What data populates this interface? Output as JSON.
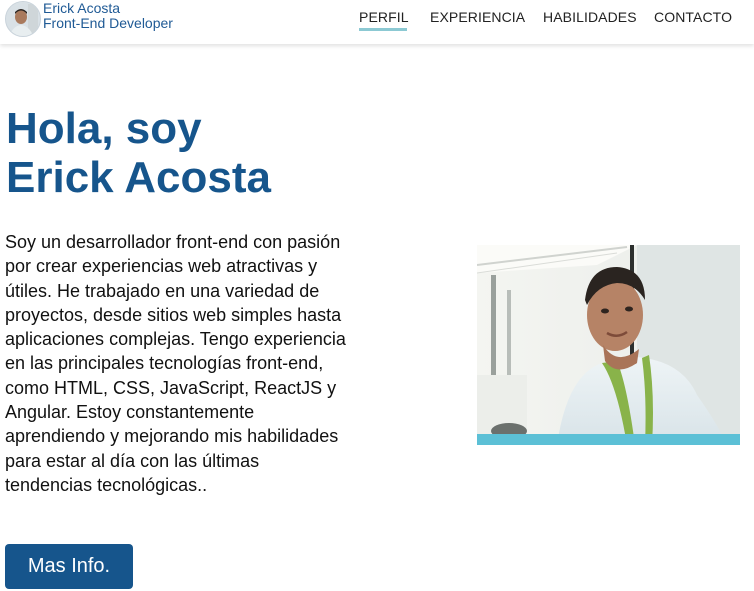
{
  "header": {
    "name": "Erick Acosta",
    "role": "Front-End Developer",
    "nav": [
      {
        "label": "PERFIL",
        "active": true
      },
      {
        "label": "EXPERIENCIA",
        "active": false
      },
      {
        "label": "HABILIDADES",
        "active": false
      },
      {
        "label": "CONTACTO",
        "active": false
      }
    ]
  },
  "hero": {
    "title_line1": "Hola, soy",
    "title_line2": "Erick Acosta",
    "bio": "Soy un desarrollador front-end con pasión por crear experiencias web atractivas y útiles. He trabajado en una variedad de proyectos, desde sitios web simples hasta aplicaciones complejas. Tengo experiencia en las principales tecnologías front-end, como HTML, CSS, JavaScript, ReactJS y Angular. Estoy constantemente aprendiendo y mejorando mis habilidades para estar al día con las últimas tendencias tecnológicas..",
    "cta_label": "Mas Info."
  },
  "colors": {
    "brand": "#16558c",
    "accent": "#5cc0d6",
    "nav_underline": "#8cc9d3"
  }
}
